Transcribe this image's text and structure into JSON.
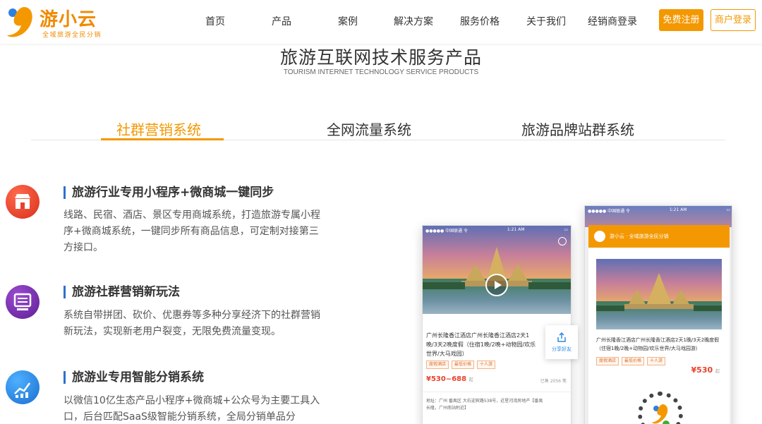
{
  "header": {
    "brand_name": "游小云",
    "brand_slogan": "全域旅游全民分销",
    "nav": [
      {
        "label": "首页"
      },
      {
        "label": "产品"
      },
      {
        "label": "案例"
      },
      {
        "label": "解决方案"
      },
      {
        "label": "服务价格"
      },
      {
        "label": "关于我们"
      },
      {
        "label": "经销商登录"
      }
    ],
    "register_label": "免费注册",
    "login_label": "商户登录"
  },
  "section": {
    "title": "旅游互联网技术服务产品",
    "subtitle": "TOURISM INTERNET TECHNOLOGY SERVICE PRODUCTS"
  },
  "tabs": [
    {
      "label": "社群营销系统",
      "active": true
    },
    {
      "label": "全网流量系统",
      "active": false
    },
    {
      "label": "旅游品牌站群系统",
      "active": false
    }
  ],
  "features": [
    {
      "title": "旅游行业专用小程序+微商城一键同步",
      "desc": "线路、民宿、酒店、景区专用商城系统，打造旅游专属小程序+微商城系统，一键同步所有商品信息，可定制对接第三方接口。",
      "icon": "store-icon",
      "color": "#e8412b"
    },
    {
      "title": "旅游社群营销新玩法",
      "desc": "系统自带拼团、砍价、优惠券等多种分享经济下的社群营销新玩法，实现新老用户裂变，无限免费流量变现。",
      "icon": "monitor-icon",
      "color": "#7b2fb0"
    },
    {
      "title": "旅游业专用智能分销系统",
      "desc": "以微信10亿生态产品小程序+微商城+公众号为主要工具入口，后台匹配SaaS级智能分销系统，全局分销单品分",
      "icon": "chart-icon",
      "color": "#2a8be0"
    }
  ],
  "phone_left": {
    "carrier": "●●●●● 中国联通 令",
    "time": "1:21 AM",
    "product_title": "广州长隆香江酒店广州长隆香江酒店2天1晚/3天2晚度假（住宿1晚/2晚+动物园/欢乐世界/大马戏园）",
    "tags": [
      "度假酒店",
      "最低价格",
      "十人游"
    ],
    "price": "¥530~688",
    "price_suffix": "起",
    "sold": "已售 2056 笔",
    "address": "地址：广州 番禺区 大石迎宾路538号，近星河湾房地产【番禺长隆，广州南站附近】",
    "share_label": "分享好友"
  },
  "phone_right": {
    "carrier": "●●●●● 中国联通 令",
    "time": "1:21 AM",
    "brand_line": "游小云 · 全域旅游全民分销",
    "product_title": "广州长隆香江酒店广州长隆香江酒店2天1晚/3天2晚度假（住宿1晚/2晚+动物园/欢乐世界/大马戏园游）",
    "tags": [
      "度假酒店",
      "最低价格",
      "十人游"
    ],
    "price": "¥530",
    "price_suffix": "起"
  },
  "colors": {
    "accent": "#f39800",
    "tab_active": "#f39800",
    "title_bar": "#2f6fcf"
  }
}
